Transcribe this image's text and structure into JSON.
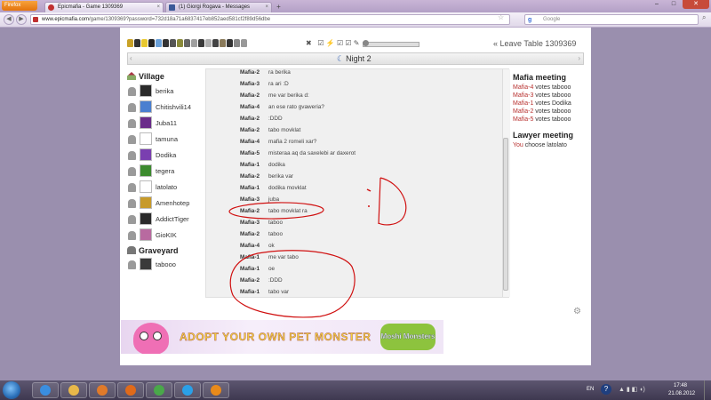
{
  "browser": {
    "menu_button": "Firefox",
    "tabs": [
      {
        "title": "Epicmafia - Game 1309369",
        "favicon": "epicmafia-icon"
      },
      {
        "title": "(1) Giorgi Rogava - Messages",
        "favicon": "facebook-icon"
      }
    ],
    "url_domain": "www.epicmafia.com",
    "url_path": "/game/1309369?password=732d18a71a6837417eb852aed581cf2f89d56dbe",
    "search_placeholder": "Google",
    "search_engine": "google-icon"
  },
  "game": {
    "leave_table": "« Leave Table 1309369",
    "day_label": "Night 2",
    "prev_arrow": "‹",
    "next_arrow": "›"
  },
  "village": {
    "heading": "Village",
    "players": [
      {
        "name": "berika",
        "avatar_color": "#2a2a2a"
      },
      {
        "name": "Chitishvili14",
        "avatar_color": "#4a7fd0"
      },
      {
        "name": "Juba11",
        "avatar_color": "#6a2c8a"
      },
      {
        "name": "tamuna",
        "avatar_color": "#ffffff"
      },
      {
        "name": "Dodika",
        "avatar_color": "#7a3fb0"
      },
      {
        "name": "tegera",
        "avatar_color": "#3c8a2e"
      },
      {
        "name": "latolato",
        "avatar_color": "#ffffff"
      },
      {
        "name": "Amenhotep",
        "avatar_color": "#c79a2a"
      },
      {
        "name": "AddictTiger",
        "avatar_color": "#2a2a2a"
      },
      {
        "name": "GioKIK",
        "avatar_color": "#b86aa0"
      }
    ]
  },
  "graveyard": {
    "heading": "Graveyard",
    "players": [
      {
        "name": "tabooo",
        "avatar_color": "#3a3a3a"
      }
    ]
  },
  "chat": {
    "messages": [
      {
        "who": "Mafia-2",
        "text": "ra berika"
      },
      {
        "who": "Mafia-3",
        "text": "ra ari :D"
      },
      {
        "who": "Mafia-2",
        "text": "me var berika d:"
      },
      {
        "who": "Mafia-4",
        "text": "an ese rato gvaweria?"
      },
      {
        "who": "Mafia-2",
        "text": ":DDD"
      },
      {
        "who": "Mafia-2",
        "text": "tabo movklat"
      },
      {
        "who": "Mafia-4",
        "text": "mafia 2 romeli xar?"
      },
      {
        "who": "Mafia-5",
        "text": "misteraa aq da saxelebi ar daxerot"
      },
      {
        "who": "Mafia-1",
        "text": "dodika"
      },
      {
        "who": "Mafia-2",
        "text": "berika var"
      },
      {
        "who": "Mafia-1",
        "text": "dodika movklat"
      },
      {
        "who": "Mafia-3",
        "text": "juba"
      },
      {
        "who": "Mafia-2",
        "text": "tabo movklat ra"
      },
      {
        "who": "Mafia-3",
        "text": "taboo"
      },
      {
        "who": "Mafia-2",
        "text": "taboo"
      },
      {
        "who": "Mafia-4",
        "text": "ok"
      },
      {
        "who": "Mafia-1",
        "text": "me var tabo"
      },
      {
        "who": "Mafia-1",
        "text": "oe"
      },
      {
        "who": "Mafia-2",
        "text": ":DDD"
      },
      {
        "who": "Mafia-1",
        "text": "tabo var"
      }
    ]
  },
  "mafia_meeting": {
    "heading": "Mafia meeting",
    "votes": [
      {
        "voter": "Mafia-4",
        "rest": "votes tabooo"
      },
      {
        "voter": "Mafia-3",
        "rest": "votes tabooo"
      },
      {
        "voter": "Mafia-1",
        "rest": "votes Dodika"
      },
      {
        "voter": "Mafia-2",
        "rest": "votes tabooo"
      },
      {
        "voter": "Mafia-5",
        "rest": "votes tabooo"
      }
    ]
  },
  "lawyer_meeting": {
    "heading": "Lawyer meeting",
    "votes": [
      {
        "voter": "You",
        "rest": "choose latolato"
      }
    ]
  },
  "ad": {
    "text": "ADOPT YOUR OWN PET MONSTER",
    "logo": "Moshi Monsters"
  },
  "taskbar": {
    "language": "EN",
    "help": "?",
    "time": "17:48",
    "date": "21.08.2012",
    "apps": [
      {
        "icon": "internet-explorer-icon",
        "color": "#3a8ee0"
      },
      {
        "icon": "file-explorer-icon",
        "color": "#e8b84a"
      },
      {
        "icon": "media-player-icon",
        "color": "#e07a2a"
      },
      {
        "icon": "firefox-icon",
        "color": "#e06a1a"
      },
      {
        "icon": "chrome-icon",
        "color": "#4aa84a"
      },
      {
        "icon": "skype-icon",
        "color": "#2aa0e8"
      },
      {
        "icon": "outlook-icon",
        "color": "#e88a1a"
      }
    ]
  },
  "colors": {
    "mafia_voter": "#b8312f",
    "annotation": "#d01010"
  }
}
